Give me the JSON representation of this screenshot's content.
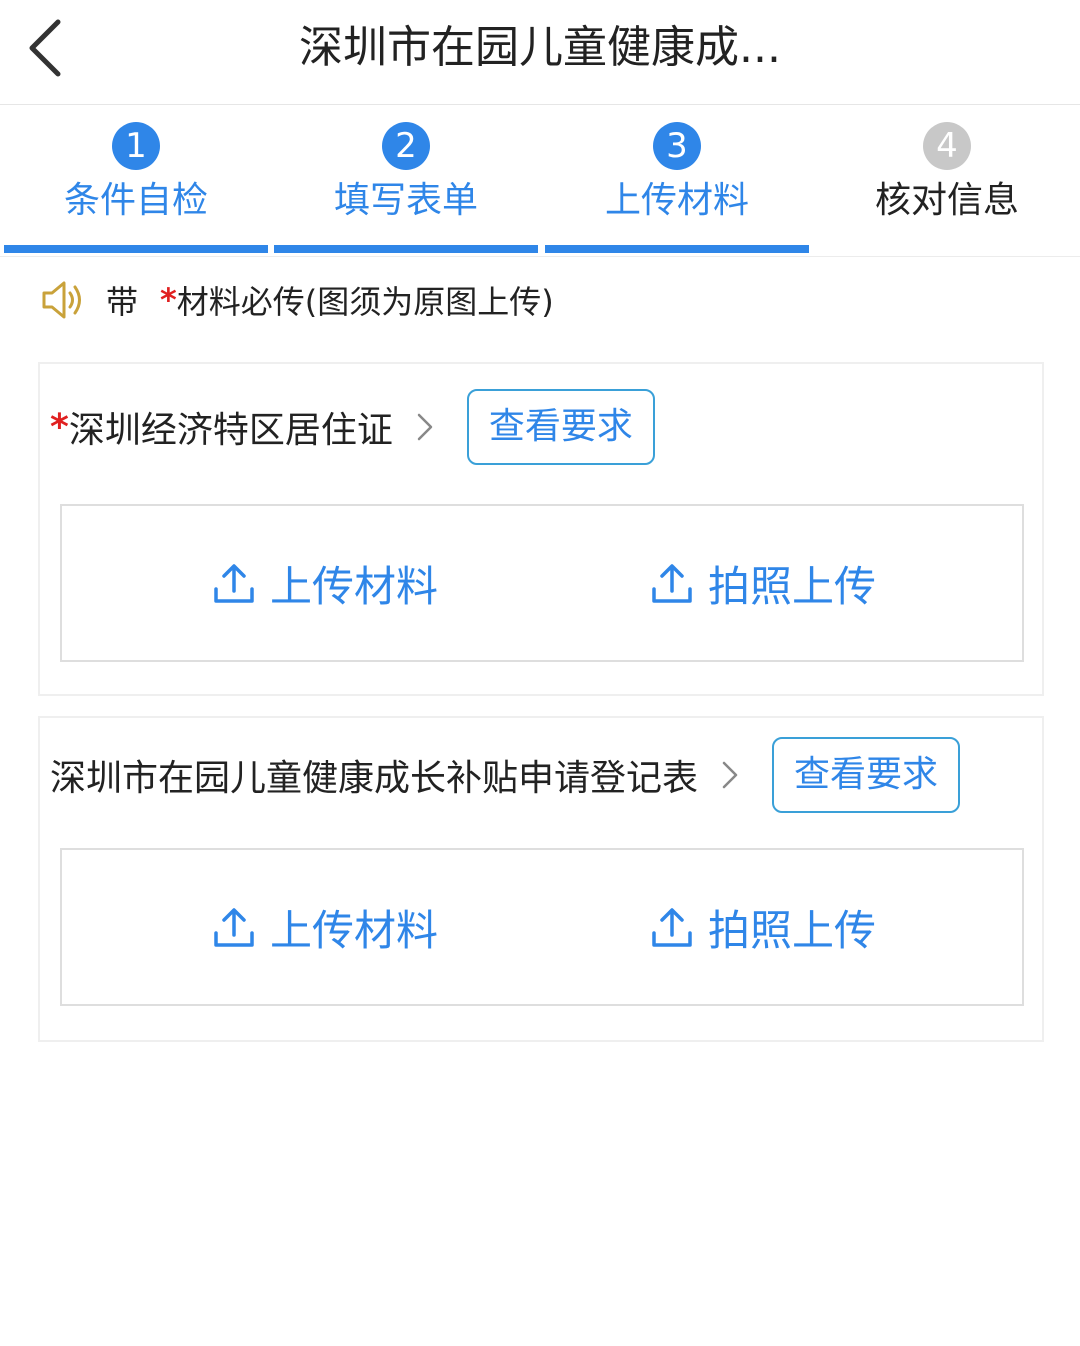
{
  "header": {
    "title": "深圳市在园儿童健康成..."
  },
  "steps": [
    {
      "num": "1",
      "label": "条件自检",
      "state": "done"
    },
    {
      "num": "2",
      "label": "填写表单",
      "state": "done"
    },
    {
      "num": "3",
      "label": "上传材料",
      "state": "current"
    },
    {
      "num": "4",
      "label": "核对信息",
      "state": "pending"
    }
  ],
  "notice": {
    "prefix": "带",
    "star": "*",
    "text": "材料必传(图须为原图上传)"
  },
  "materials": [
    {
      "required_star": "*",
      "title": "深圳经济特区居住证",
      "requirement_button": "查看要求",
      "upload_label": "上传材料",
      "photo_label": "拍照上传"
    },
    {
      "required_star": "",
      "title": "深圳市在园儿童健康成长补贴申请登记表",
      "requirement_button": "查看要求",
      "upload_label": "上传材料",
      "photo_label": "拍照上传"
    }
  ],
  "colors": {
    "accent": "#2f86e8",
    "required": "#e02020",
    "inactive_step": "#c8c8c8",
    "speaker_icon": "#c9a23a"
  }
}
